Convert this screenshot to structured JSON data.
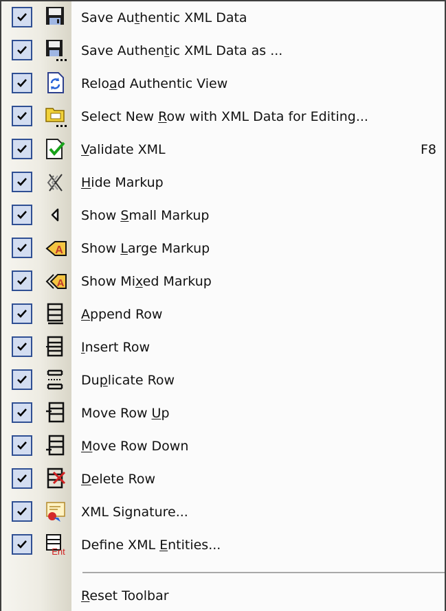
{
  "menu": {
    "items": [
      {
        "label": "Save Authentic XML Data",
        "mnemonic_index": 7,
        "checked": true,
        "icon": "save-disk-icon",
        "shortcut": ""
      },
      {
        "label": "Save Authentic XML Data as ...",
        "mnemonic_index": 11,
        "checked": true,
        "icon": "save-as-disk-icon",
        "shortcut": ""
      },
      {
        "label": "Reload Authentic View",
        "mnemonic_index": 4,
        "checked": true,
        "icon": "reload-icon",
        "shortcut": ""
      },
      {
        "label": "Select New Row with XML Data for Editing...",
        "mnemonic_index": 11,
        "checked": true,
        "icon": "select-row-icon",
        "shortcut": ""
      },
      {
        "label": "Validate XML",
        "mnemonic_index": 0,
        "checked": true,
        "icon": "validate-icon",
        "shortcut": "F8"
      },
      {
        "label": "Hide Markup",
        "mnemonic_index": 0,
        "checked": true,
        "icon": "hide-markup-icon",
        "shortcut": ""
      },
      {
        "label": "Show Small Markup",
        "mnemonic_index": 5,
        "checked": true,
        "icon": "small-markup-icon",
        "shortcut": ""
      },
      {
        "label": "Show Large Markup",
        "mnemonic_index": 5,
        "checked": true,
        "icon": "large-markup-icon",
        "shortcut": ""
      },
      {
        "label": "Show Mixed Markup",
        "mnemonic_index": 7,
        "checked": true,
        "icon": "mixed-markup-icon",
        "shortcut": ""
      },
      {
        "label": "Append Row",
        "mnemonic_index": 0,
        "checked": true,
        "icon": "append-row-icon",
        "shortcut": ""
      },
      {
        "label": "Insert Row",
        "mnemonic_index": 0,
        "checked": true,
        "icon": "insert-row-icon",
        "shortcut": ""
      },
      {
        "label": "Duplicate Row",
        "mnemonic_index": 2,
        "checked": true,
        "icon": "duplicate-row-icon",
        "shortcut": ""
      },
      {
        "label": "Move Row Up",
        "mnemonic_index": 9,
        "checked": true,
        "icon": "move-row-up-icon",
        "shortcut": ""
      },
      {
        "label": "Move Row Down",
        "mnemonic_index": 0,
        "checked": true,
        "icon": "move-row-down-icon",
        "shortcut": ""
      },
      {
        "label": "Delete Row",
        "mnemonic_index": 0,
        "checked": true,
        "icon": "delete-row-icon",
        "shortcut": ""
      },
      {
        "label": "XML Signature...",
        "mnemonic_index": -1,
        "checked": true,
        "icon": "xml-signature-icon",
        "shortcut": ""
      },
      {
        "label": "Define XML Entities...",
        "mnemonic_index": 11,
        "checked": true,
        "icon": "define-entities-icon",
        "shortcut": ""
      }
    ],
    "footer": {
      "label": "Reset Toolbar",
      "mnemonic_index": 0
    },
    "colors": {
      "check_border": "#2f4f93",
      "check_fill": "#d3ddf1",
      "text": "#111111",
      "separator": "#a9a9a9"
    }
  }
}
